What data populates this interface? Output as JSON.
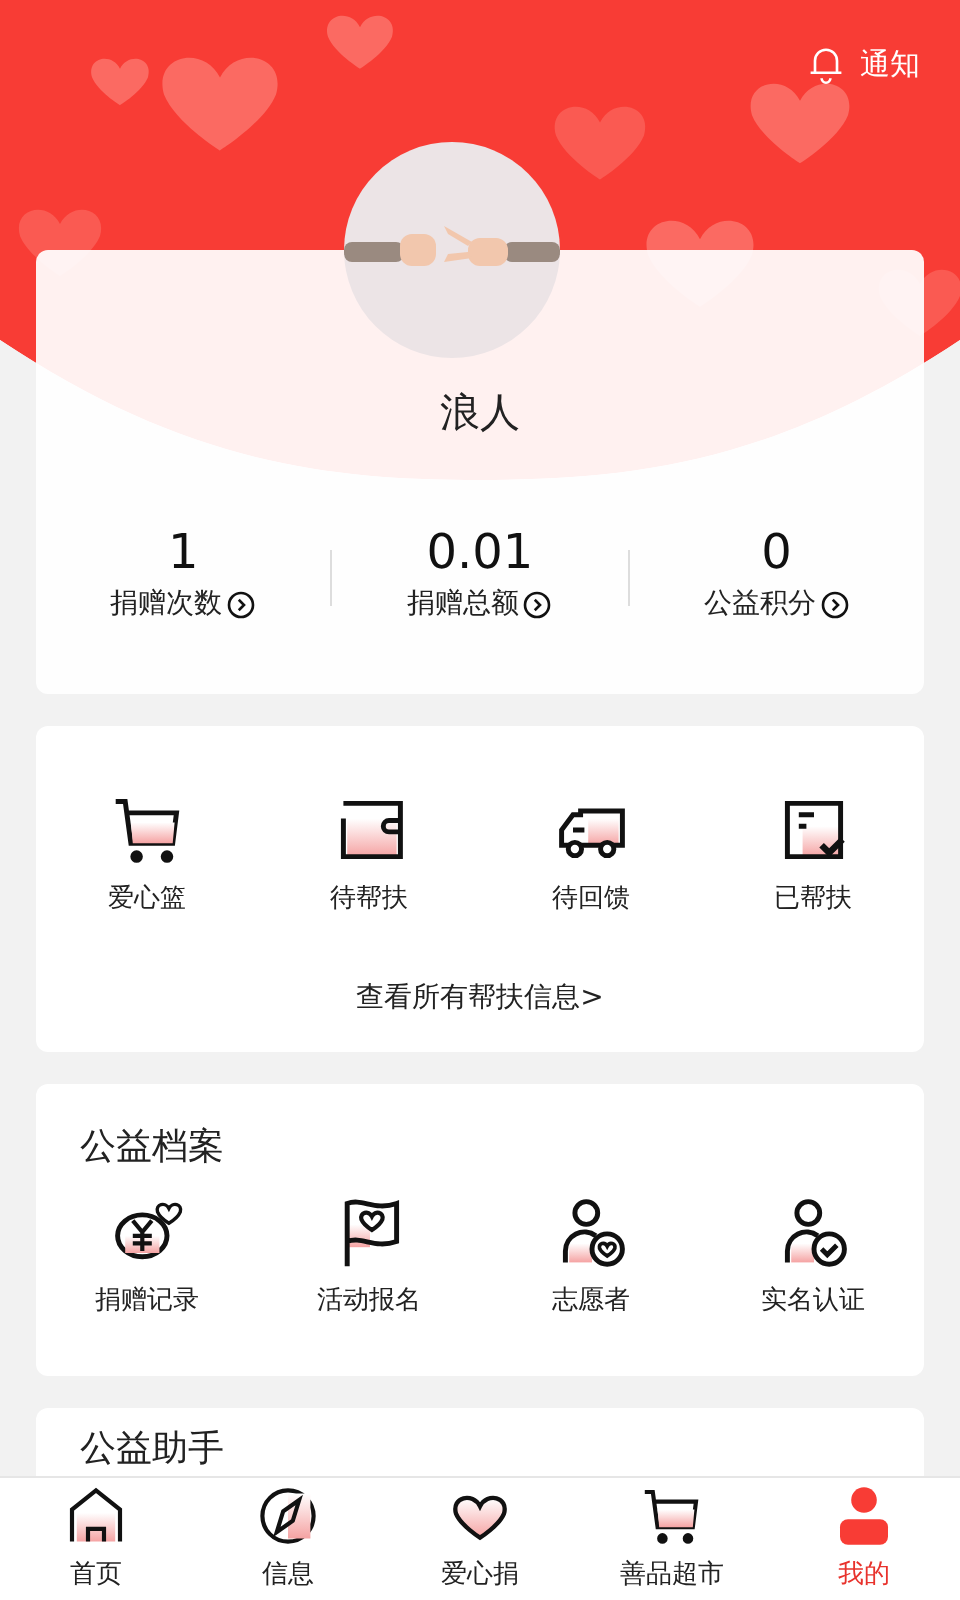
{
  "header": {
    "notice": "通知"
  },
  "profile": {
    "name": "浪人",
    "stats": [
      {
        "value": "1",
        "label": "捐赠次数"
      },
      {
        "value": "0.01",
        "label": "捐赠总额"
      },
      {
        "value": "0",
        "label": "公益积分"
      }
    ]
  },
  "help": {
    "items": [
      "爱心篮",
      "待帮扶",
      "待回馈",
      "已帮扶"
    ],
    "link": "查看所有帮扶信息>"
  },
  "archive": {
    "title": "公益档案",
    "items": [
      "捐赠记录",
      "活动报名",
      "志愿者",
      "实名认证"
    ]
  },
  "assistant": {
    "title": "公益助手"
  },
  "tabbar": [
    {
      "label": "首页",
      "selected": false
    },
    {
      "label": "信息",
      "selected": false
    },
    {
      "label": "爱心捐",
      "selected": false
    },
    {
      "label": "善品超市",
      "selected": false
    },
    {
      "label": "我的",
      "selected": true
    }
  ]
}
